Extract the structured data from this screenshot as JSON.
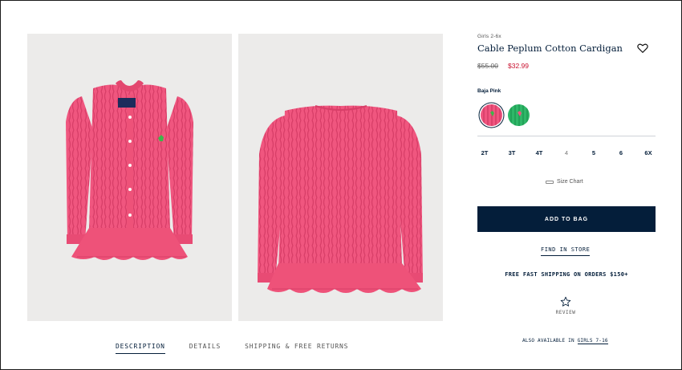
{
  "product": {
    "category": "Girls 2-6x",
    "title": "Cable Peplum Cotton Cardigan",
    "price_original": "$55.00",
    "price_sale": "$32.99",
    "color_name": "Baja Pink",
    "swatches": [
      {
        "name": "Baja Pink",
        "selected": true,
        "color": "#f0547f"
      },
      {
        "name": "green",
        "selected": false,
        "color": "#2fb768"
      }
    ],
    "sizes": [
      {
        "label": "2T",
        "available": true
      },
      {
        "label": "3T",
        "available": true
      },
      {
        "label": "4T",
        "available": true
      },
      {
        "label": "4",
        "available": false
      },
      {
        "label": "5",
        "available": true
      },
      {
        "label": "6",
        "available": true
      },
      {
        "label": "6X",
        "available": true
      }
    ],
    "size_chart_label": "Size Chart",
    "add_to_bag_label": "ADD TO BAG",
    "find_in_store_label": "FIND IN STORE",
    "shipping_text": "FREE FAST SHIPPING ON ORDERS $150+",
    "review_label": "REVIEW"
  },
  "tabs": [
    {
      "label": "DESCRIPTION",
      "active": true
    },
    {
      "label": "DETAILS",
      "active": false
    },
    {
      "label": "SHIPPING & FREE RETURNS",
      "active": false
    }
  ],
  "also_available": {
    "prefix": "ALSO AVAILABLE IN ",
    "link": "GIRLS 7-16"
  },
  "images": {
    "front_alt_icon": "cardigan-front-image",
    "back_alt_icon": "cardigan-back-image"
  },
  "colors": {
    "navy": "#041e3a",
    "sale_red": "#c8102e",
    "sweater_pink": "#f0547f",
    "photo_bg": "#ecebea"
  }
}
